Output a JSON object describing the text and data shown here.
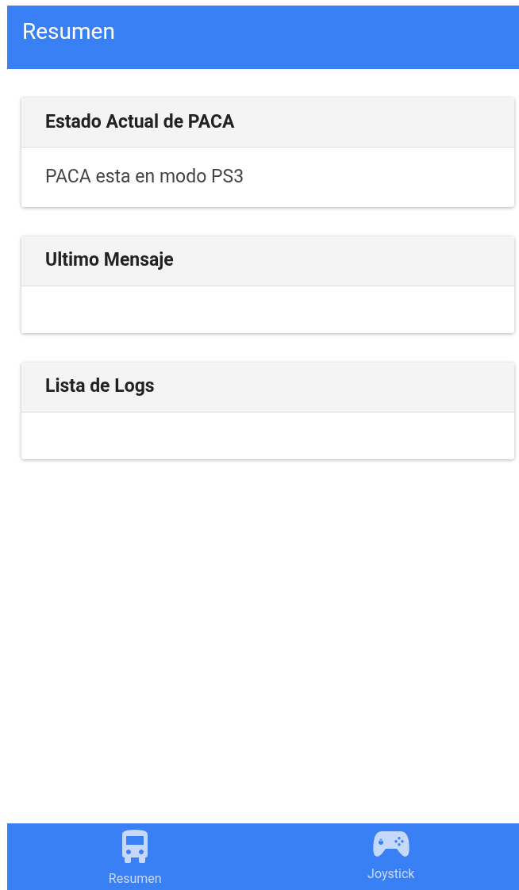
{
  "header": {
    "title": "Resumen"
  },
  "cards": [
    {
      "title": "Estado Actual de PACA",
      "body": "PACA esta en modo PS3"
    },
    {
      "title": "Ultimo Mensaje"
    },
    {
      "title": "Lista de Logs"
    }
  ],
  "bottom_nav": [
    {
      "label": "Resumen",
      "kind": "bus"
    },
    {
      "label": "Joystick",
      "kind": "gamepad"
    }
  ]
}
